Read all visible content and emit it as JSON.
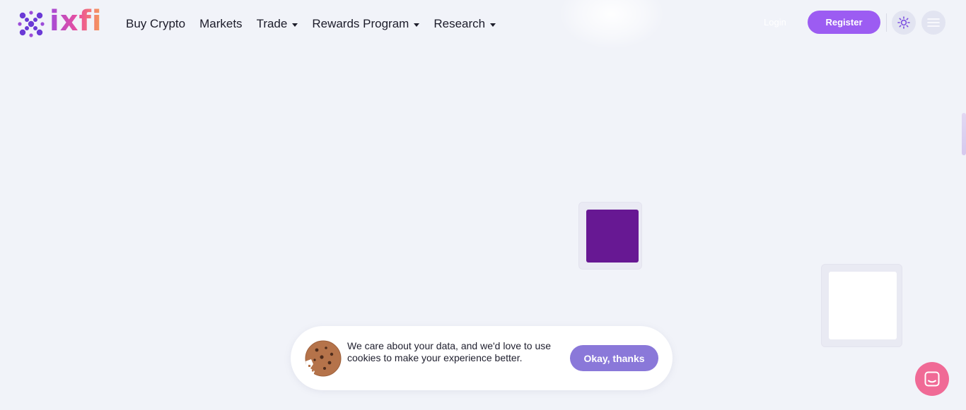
{
  "brand": {
    "name": "ixfi",
    "accent": "#9c5cf2"
  },
  "nav": {
    "items": [
      {
        "label": "Buy Crypto",
        "dropdown": false
      },
      {
        "label": "Markets",
        "dropdown": false
      },
      {
        "label": "Trade",
        "dropdown": true
      },
      {
        "label": "Rewards Program",
        "dropdown": true
      },
      {
        "label": "Research",
        "dropdown": true
      }
    ]
  },
  "header": {
    "login_label": "Login",
    "register_label": "Register",
    "theme_icon": "sun-icon",
    "menu_icon": "hamburger-menu-icon"
  },
  "cookie_banner": {
    "message": "We care about your data, and we'd love to use cookies to make your experience better.",
    "button_label": "Okay, thanks",
    "icon": "cookie-icon"
  },
  "chat": {
    "icon": "chat-icon",
    "color": "#f06a96"
  },
  "colors": {
    "purple_block": "#671893",
    "background": "#f1f3f9"
  }
}
